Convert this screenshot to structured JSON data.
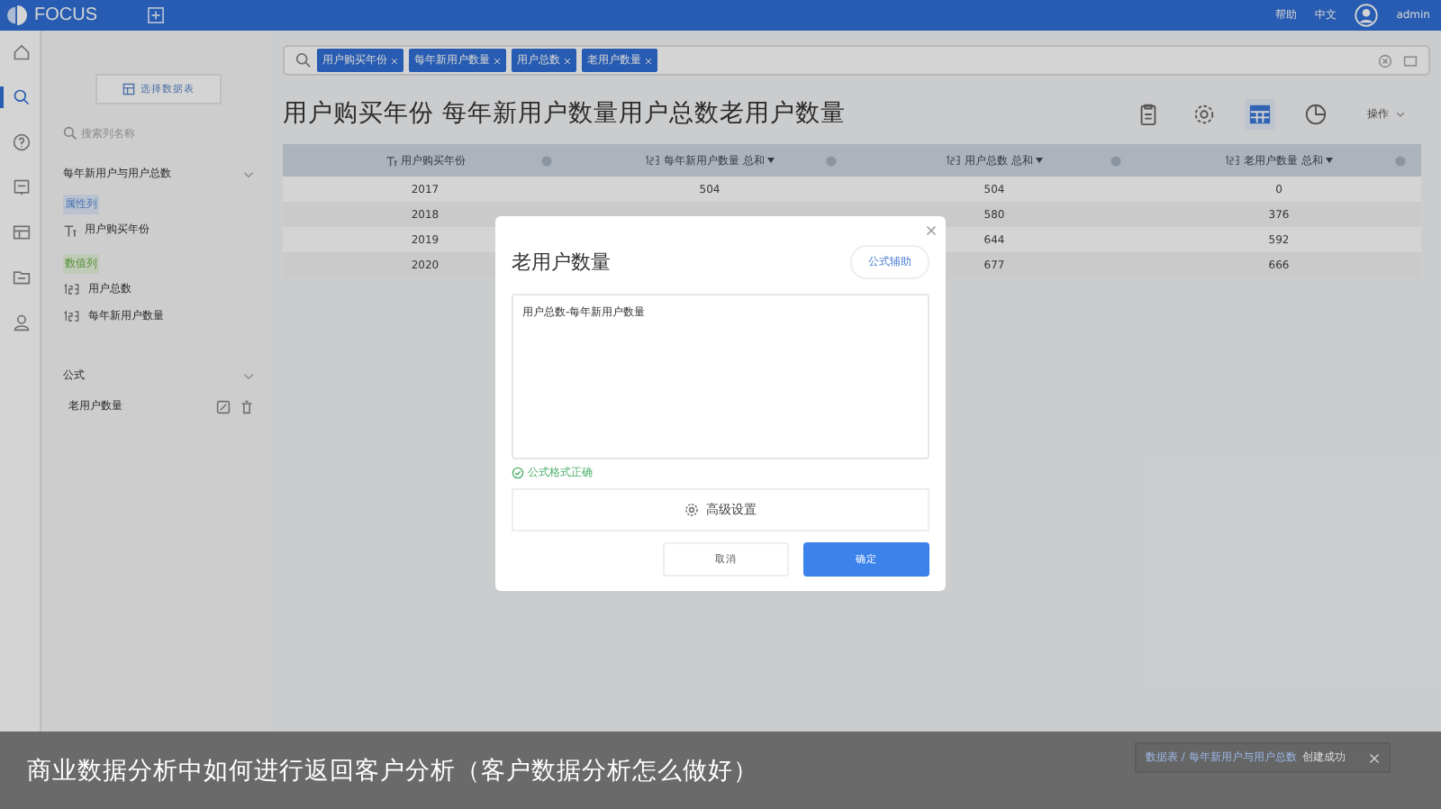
{
  "topbar": {
    "logo": "FOCUS",
    "links": [
      "帮助",
      "中文"
    ],
    "user": "admin"
  },
  "rail": [
    {
      "selected": false
    },
    {
      "selected": true
    },
    {
      "selected": false
    },
    {
      "selected": false
    },
    {
      "selected": false
    },
    {
      "selected": false
    },
    {
      "selected": false
    }
  ],
  "sidebar": {
    "select_button": "选择数据表",
    "search": {
      "placeholder": "搜索列名称"
    },
    "table_section": {
      "title": "每年新用户与用户总数",
      "groups": [
        {
          "label": "属性列",
          "kind": "attribute",
          "items": [
            "用户购买年份"
          ]
        },
        {
          "label": "数值列",
          "kind": "numeric",
          "items": [
            "用户总数",
            "每年新用户数量"
          ]
        }
      ]
    },
    "formula_section": {
      "title": "公式",
      "items": [
        "老用户数量"
      ]
    }
  },
  "search_bar": {
    "tags": [
      "用户购买年份",
      "每年新用户数量",
      "用户总数",
      "老用户数量"
    ]
  },
  "title": "用户购买年份 每年新用户数量用户总数老用户数量",
  "toolbar": {
    "views": [
      {
        "selected": false
      },
      {
        "selected": false
      },
      {
        "selected": true
      },
      {
        "selected": false
      }
    ],
    "menu": "操作"
  },
  "table": {
    "columns": [
      {
        "label": "用户购买年份",
        "kind": "attribute"
      },
      {
        "label": "每年新用户数量 总和",
        "kind": "numeric"
      },
      {
        "label": "用户总数 总和",
        "kind": "numeric"
      },
      {
        "label": "老用户数量 总和",
        "kind": "numeric"
      }
    ],
    "rows": [
      [
        "2017",
        "504",
        "504",
        "0"
      ],
      [
        "2018",
        null,
        "580",
        "376"
      ],
      [
        "2019",
        null,
        "644",
        "592"
      ],
      [
        "2020",
        null,
        "677",
        "666"
      ]
    ]
  },
  "dialog": {
    "title": "老用户数量",
    "help_button": "公式辅助",
    "formula": "用户总数-每年新用户数量",
    "status": "公式格式正确",
    "valid": true,
    "advanced": "高级设置",
    "cancel": "取消",
    "confirm": "确定"
  },
  "toast": {
    "path": "数据表 / 每年新用户与用户总数",
    "message": "创建成功"
  },
  "caption": "商业数据分析中如何进行返回客户分析（客户数据分析怎么做好）"
}
